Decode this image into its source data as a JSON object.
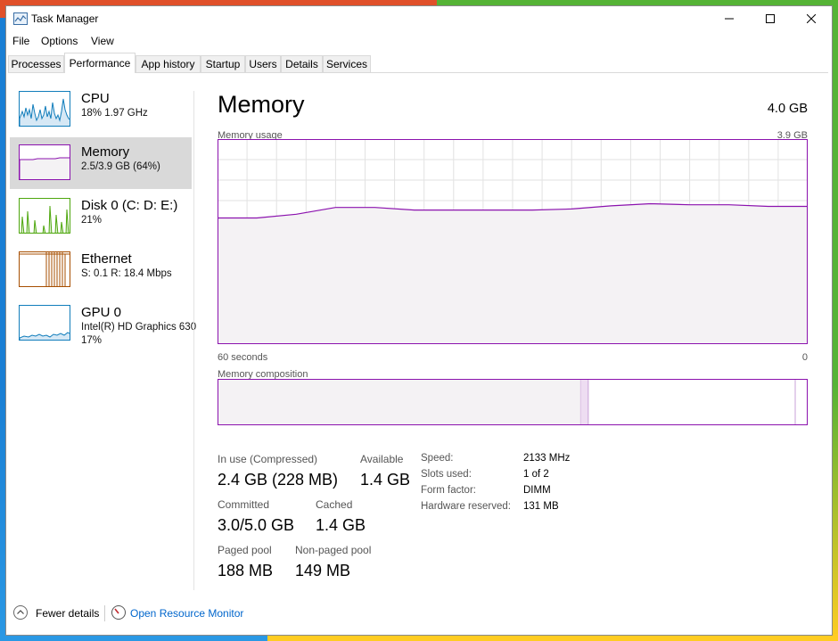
{
  "window": {
    "title": "Task Manager"
  },
  "menu": [
    "File",
    "Options",
    "View"
  ],
  "tabs": [
    "Processes",
    "Performance",
    "App history",
    "Startup",
    "Users",
    "Details",
    "Services"
  ],
  "sidebar": {
    "items": [
      {
        "name": "CPU",
        "sub": "18%  1.97 GHz",
        "sub2": "",
        "color": "#117dbb"
      },
      {
        "name": "Memory",
        "sub": "2.5/3.9 GB (64%)",
        "sub2": "",
        "color": "#8b12ae"
      },
      {
        "name": "Disk 0 (C: D: E:)",
        "sub": "21%",
        "sub2": "",
        "color": "#4da60c"
      },
      {
        "name": "Ethernet",
        "sub": "S: 0.1  R: 18.4 Mbps",
        "sub2": "",
        "color": "#a74f01"
      },
      {
        "name": "GPU 0",
        "sub": "Intel(R) HD Graphics 630",
        "sub2": "17%",
        "color": "#117dbb"
      }
    ]
  },
  "main": {
    "title": "Memory",
    "total": "4.0 GB",
    "usage_label": "Memory usage",
    "usage_max": "3.9 GB",
    "time_left": "60 seconds",
    "time_right": "0",
    "composition_label": "Memory composition",
    "accent_color": "#8b12ae",
    "stats": {
      "in_use_label": "In use (Compressed)",
      "in_use": "2.4 GB (228 MB)",
      "available_label": "Available",
      "available": "1.4 GB",
      "committed_label": "Committed",
      "committed": "3.0/5.0 GB",
      "cached_label": "Cached",
      "cached": "1.4 GB",
      "paged_label": "Paged pool",
      "paged": "188 MB",
      "nonpaged_label": "Non-paged pool",
      "nonpaged": "149 MB"
    },
    "props": [
      {
        "label": "Speed:",
        "value": "2133 MHz"
      },
      {
        "label": "Slots used:",
        "value": "1 of 2"
      },
      {
        "label": "Form factor:",
        "value": "DIMM"
      },
      {
        "label": "Hardware reserved:",
        "value": "131 MB"
      }
    ]
  },
  "chart_data": {
    "type": "area",
    "ylim": [
      0,
      3.9
    ],
    "x": [
      60,
      56,
      52,
      48,
      44,
      40,
      36,
      32,
      28,
      24,
      20,
      16,
      12,
      8,
      4,
      0
    ],
    "values": [
      2.4,
      2.4,
      2.47,
      2.6,
      2.6,
      2.55,
      2.55,
      2.55,
      2.55,
      2.57,
      2.63,
      2.67,
      2.65,
      2.65,
      2.62,
      2.62
    ],
    "composition": {
      "in_use": 2.4,
      "modified": 0.05,
      "standby": 1.4,
      "free": 0.05,
      "total": 3.9
    }
  },
  "footer": {
    "fewer": "Fewer details",
    "monitor": "Open Resource Monitor"
  }
}
